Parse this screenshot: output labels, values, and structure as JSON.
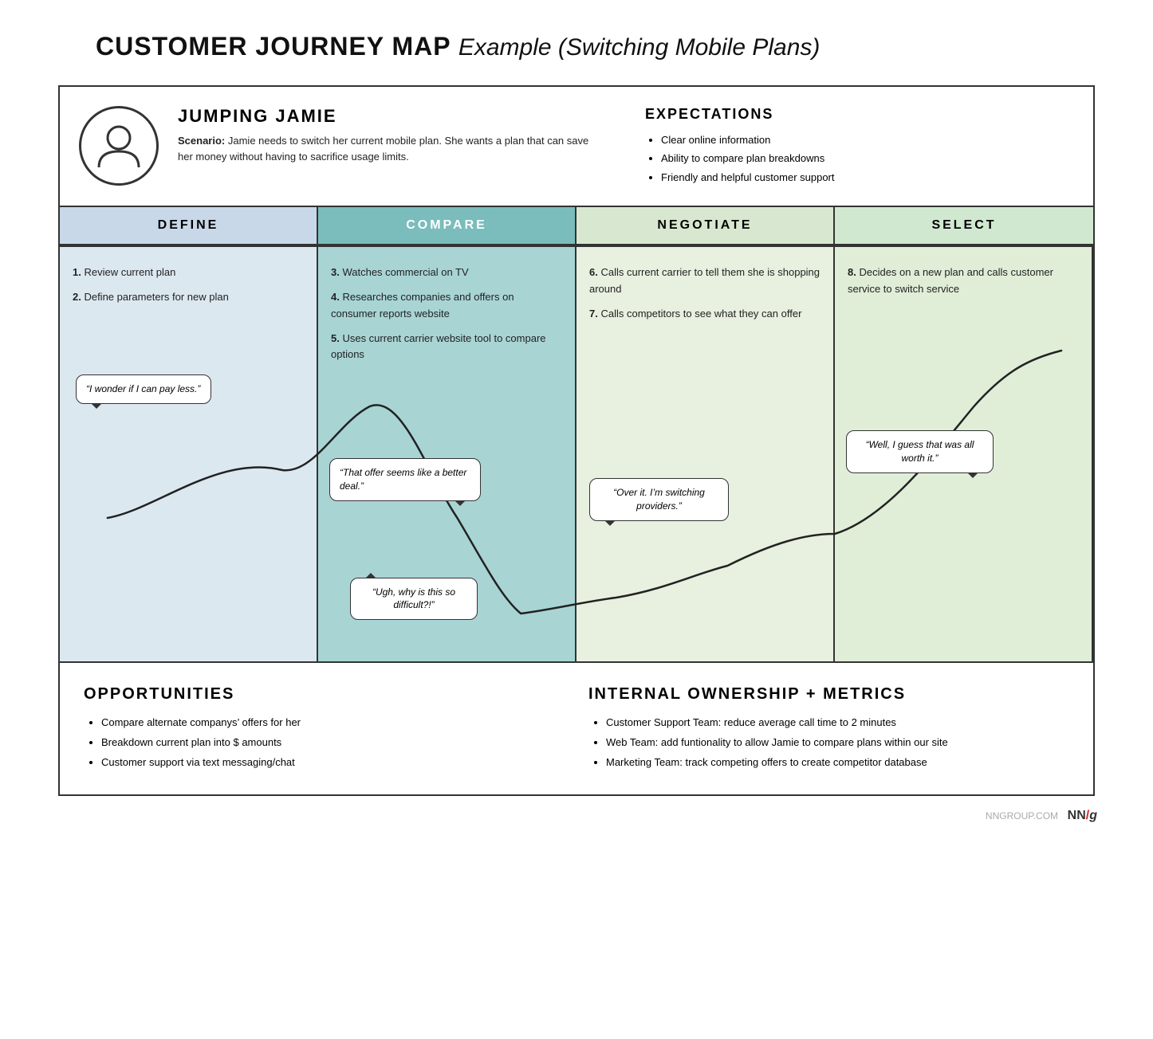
{
  "page": {
    "title_bold": "CUSTOMER JOURNEY MAP",
    "title_italic": "Example (Switching Mobile Plans)"
  },
  "persona": {
    "name": "JUMPING JAMIE",
    "scenario_label": "Scenario:",
    "scenario_text": "Jamie needs to switch her current mobile plan. She wants a plan that can save her money without having to sacrifice usage limits.",
    "expectations_title": "EXPECTATIONS",
    "expectations": [
      "Clear online information",
      "Ability to compare plan breakdowns",
      "Friendly and helpful customer support"
    ]
  },
  "phases": [
    {
      "id": "define",
      "label": "DEFINE",
      "steps": [
        {
          "num": "1.",
          "text": "Review current plan"
        },
        {
          "num": "2.",
          "text": "Define parameters for new plan"
        }
      ],
      "bubble": "\"I wonder if I can pay less.\""
    },
    {
      "id": "compare",
      "label": "COMPARE",
      "steps": [
        {
          "num": "3.",
          "text": "Watches commercial on TV"
        },
        {
          "num": "4.",
          "text": "Researches companies and offers on consumer reports website"
        },
        {
          "num": "5.",
          "text": "Uses current carrier website tool to compare options"
        }
      ],
      "bubble": "\"That offer seems like a better deal.\""
    },
    {
      "id": "negotiate",
      "label": "NEGOTIATE",
      "steps": [
        {
          "num": "6.",
          "text": "Calls current carrier to tell them she is shopping around"
        },
        {
          "num": "7.",
          "text": "Calls competitors to see what they can offer"
        }
      ],
      "bubble": "\"Over it. I'm switching providers.\""
    },
    {
      "id": "select",
      "label": "SELECT",
      "steps": [
        {
          "num": "8.",
          "text": "Decides on a new plan and calls customer service to switch service"
        }
      ],
      "bubble": "\"Well, I guess that was all worth it.\""
    }
  ],
  "journey_bubbles": [
    {
      "text": "\"I wonder if I can pay less.\"",
      "phase": "define"
    },
    {
      "text": "\"That offer seems like a better deal.\"",
      "phase": "compare"
    },
    {
      "text": "\"Ugh, why is this so difficult?!\"",
      "phase": "compare-low"
    },
    {
      "text": "\"Over it. I'm switching providers.\"",
      "phase": "negotiate"
    },
    {
      "text": "\"Well, I guess that was all worth it.\"",
      "phase": "select"
    }
  ],
  "opportunities": {
    "title": "OPPORTUNITIES",
    "items": [
      "Compare alternate companys' offers for her",
      "Breakdown current plan into $ amounts",
      "Customer support via text messaging/chat"
    ]
  },
  "internal_ownership": {
    "title": "INTERNAL OWNERSHIP + METRICS",
    "items": [
      "Customer Support Team: reduce average call time to 2 minutes",
      "Web Team: add funtionality to allow Jamie to compare plans within our site",
      "Marketing Team: track competing offers to create competitor database"
    ]
  },
  "branding": {
    "site": "NNGROUP.COM",
    "nn": "NN",
    "slash": "/",
    "g": "g"
  }
}
